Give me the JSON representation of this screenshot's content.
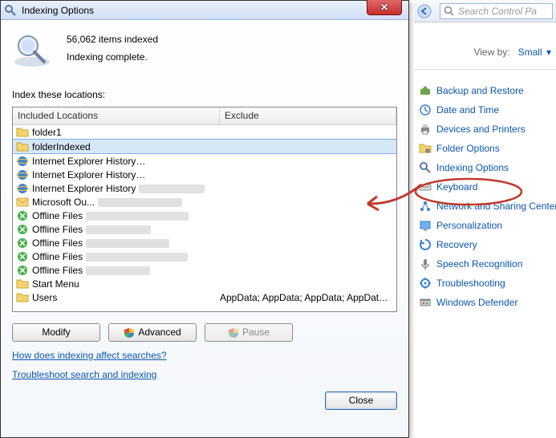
{
  "dialog": {
    "title": "Indexing Options",
    "items_indexed_text": "56,062 items indexed",
    "status_text": "Indexing complete.",
    "locations_heading": "Index these locations:",
    "columns": {
      "included": "Included Locations",
      "exclude": "Exclude"
    },
    "rows": [
      {
        "icon": "folder",
        "label": "folder1",
        "blur": false,
        "exclude": "",
        "selected": false
      },
      {
        "icon": "folder",
        "label": "folderIndexed",
        "blur": false,
        "exclude": "",
        "selected": true
      },
      {
        "icon": "ie",
        "label": "Internet Explorer History",
        "blur": true,
        "exclude": "",
        "selected": false
      },
      {
        "icon": "ie",
        "label": "Internet Explorer History",
        "blur": true,
        "exclude": "",
        "selected": false
      },
      {
        "icon": "ie",
        "label": "Internet Explorer History",
        "blur": true,
        "exclude": "",
        "selected": false
      },
      {
        "icon": "outlook",
        "label": "Microsoft Ou...",
        "blur": true,
        "exclude": "",
        "selected": false
      },
      {
        "icon": "offline",
        "label": "Offline Files",
        "blur": true,
        "exclude": "",
        "selected": false
      },
      {
        "icon": "offline",
        "label": "Offline Files",
        "blur": true,
        "exclude": "",
        "selected": false
      },
      {
        "icon": "offline",
        "label": "Offline Files",
        "blur": true,
        "exclude": "",
        "selected": false
      },
      {
        "icon": "offline",
        "label": "Offline Files",
        "blur": true,
        "exclude": "",
        "selected": false
      },
      {
        "icon": "offline",
        "label": "Offline Files",
        "blur": true,
        "exclude": "",
        "selected": false
      },
      {
        "icon": "folder",
        "label": "Start Menu",
        "blur": false,
        "exclude": "",
        "selected": false
      },
      {
        "icon": "folder",
        "label": "Users",
        "blur": false,
        "exclude": "AppData; AppData; AppData; AppData; A...",
        "selected": false
      }
    ],
    "buttons": {
      "modify": "Modify",
      "advanced": "Advanced",
      "pause": "Pause",
      "close": "Close"
    },
    "links": {
      "help": "How does indexing affect searches?",
      "troubleshoot": "Troubleshoot search and indexing"
    }
  },
  "cp": {
    "search_placeholder": "Search Control Pa",
    "view_by_label": "View by:",
    "view_by_value": "Small",
    "items": [
      {
        "icon": "backup",
        "label": "Backup and Restore"
      },
      {
        "icon": "clock",
        "label": "Date and Time"
      },
      {
        "icon": "printer",
        "label": "Devices and Printers"
      },
      {
        "icon": "folderopts",
        "label": "Folder Options"
      },
      {
        "icon": "indexing",
        "label": "Indexing Options"
      },
      {
        "icon": "keyboard",
        "label": "Keyboard"
      },
      {
        "icon": "network",
        "label": "Network and Sharing Center"
      },
      {
        "icon": "personalization",
        "label": "Personalization"
      },
      {
        "icon": "recovery",
        "label": "Recovery"
      },
      {
        "icon": "speech",
        "label": "Speech Recognition"
      },
      {
        "icon": "troubleshoot",
        "label": "Troubleshooting"
      },
      {
        "icon": "defender",
        "label": "Windows Defender"
      }
    ]
  }
}
